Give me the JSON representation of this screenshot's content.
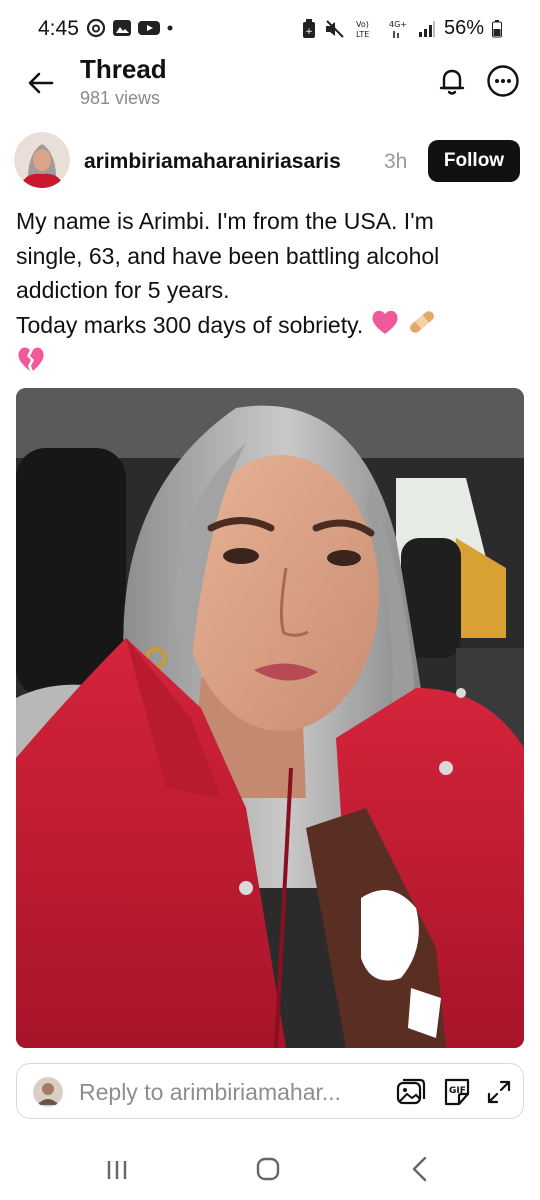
{
  "status_bar": {
    "time": "4:45",
    "battery": "56%",
    "network_label": "4G+"
  },
  "header": {
    "title": "Thread",
    "views": "981 views"
  },
  "post": {
    "username": "arimbiriamaharaniriasaris",
    "time_ago": "3h",
    "follow_label": "Follow",
    "lines": [
      "My name is Arimbi. I'm from the USA. I'm",
      "single, 63, and have been battling alcohol",
      "addiction for 5 years.",
      " Today marks 300 days of sobriety."
    ],
    "emojis": [
      "pink-heart",
      "bandage",
      "broken-heart"
    ]
  },
  "reply": {
    "placeholder": "Reply to arimbiriamahar..."
  },
  "colors": {
    "accent": "#111111",
    "muted": "#8a8a8a",
    "jacket": "#c8192e"
  }
}
